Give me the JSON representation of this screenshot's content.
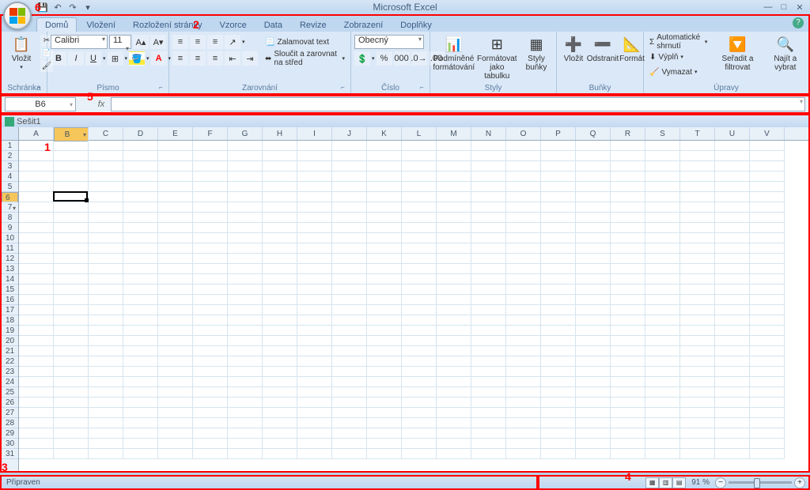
{
  "title": "Microsoft Excel",
  "qat": {
    "save": "💾",
    "undo": "↶",
    "redo": "↷"
  },
  "tabs": [
    "Domů",
    "Vložení",
    "Rozložení stránky",
    "Vzorce",
    "Data",
    "Revize",
    "Zobrazení",
    "Doplňky"
  ],
  "active_tab": 0,
  "ribbon": {
    "clipboard": {
      "label": "Schránka",
      "paste": "Vložit",
      "cut": "✂",
      "copy": "📄",
      "painter": "🖌"
    },
    "font": {
      "label": "Písmo",
      "name": "Calibri",
      "size": "11"
    },
    "align": {
      "label": "Zarovnání",
      "wrap": "Zalamovat text",
      "merge": "Sloučit a zarovnat na střed"
    },
    "number": {
      "label": "Číslo",
      "format": "Obecný"
    },
    "styles": {
      "label": "Styly",
      "cond": "Podmíněné formátování",
      "table": "Formátovat jako tabulku",
      "cell": "Styly buňky"
    },
    "cells": {
      "label": "Buňky",
      "insert": "Vložit",
      "delete": "Odstranit",
      "format": "Formát"
    },
    "editing": {
      "label": "Úpravy",
      "autosum": "Automatické shrnutí",
      "fill": "Výplň",
      "clear": "Vymazat",
      "sort": "Seřadit a filtrovat",
      "find": "Najít a vybrat"
    }
  },
  "name_box": "B6",
  "formula": "",
  "workbook_name": "Sešit1",
  "columns": [
    "A",
    "B",
    "C",
    "D",
    "E",
    "F",
    "G",
    "H",
    "I",
    "J",
    "K",
    "L",
    "M",
    "N",
    "O",
    "P",
    "Q",
    "R",
    "S",
    "T",
    "U",
    "V"
  ],
  "rows": 31,
  "active": {
    "col": "B",
    "row": 6,
    "col_idx": 1
  },
  "status": {
    "ready": "Připraven",
    "zoom": "91 %"
  },
  "annotations": {
    "a1": "1",
    "a2": "2",
    "a3": "3",
    "a4": "4",
    "a5": "5",
    "a6": "6"
  }
}
